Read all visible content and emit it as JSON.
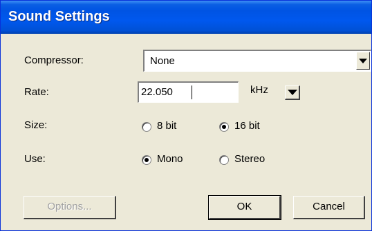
{
  "window": {
    "title": "Sound Settings"
  },
  "compressor": {
    "label": "Compressor:",
    "value": "None"
  },
  "rate": {
    "label": "Rate:",
    "value": "22.050",
    "unit": "kHz"
  },
  "size": {
    "label": "Size:",
    "options": [
      {
        "label": "8 bit",
        "selected": false
      },
      {
        "label": "16 bit",
        "selected": true
      }
    ]
  },
  "use": {
    "label": "Use:",
    "options": [
      {
        "label": "Mono",
        "selected": true
      },
      {
        "label": "Stereo",
        "selected": false
      }
    ]
  },
  "buttons": {
    "options": "Options...",
    "ok": "OK",
    "cancel": "Cancel"
  }
}
